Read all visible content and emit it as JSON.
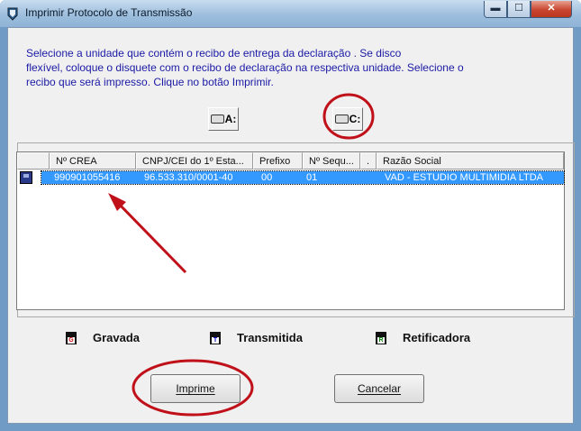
{
  "window": {
    "title": "Imprimir Protocolo de Transmissão",
    "minimize_glyph": "▬",
    "maximize_glyph": "☐",
    "close_glyph": "✕"
  },
  "instructions": [
    "Selecione a unidade que contém o recibo de entrega da declaração . Se disco",
    "flexível, coloque o disquete com o recibo de declaração na respectiva unidade. Selecione o",
    "recibo que será impresso. Clique no botão Imprimir."
  ],
  "drives": {
    "a_label": "A:",
    "c_label": "C:"
  },
  "table": {
    "columns": [
      "Nº CREA",
      "CNPJ/CEI do 1º Esta...",
      "Prefixo",
      "Nº Sequ...",
      ".",
      "Razão Social"
    ],
    "rows": [
      {
        "crea": "990901055416",
        "cnpj": "96.533.310/0001-40",
        "prefixo": "00",
        "sequencia": "01",
        "dot": "",
        "razao_social": "VAD - ESTUDIO MULTIMIDIA LTDA"
      }
    ]
  },
  "legend": [
    {
      "label": "Gravada",
      "letter": "G",
      "color": "#cc0000"
    },
    {
      "label": "Transmitida",
      "letter": "T",
      "color": "#0000cc"
    },
    {
      "label": "Retificadora",
      "letter": "R",
      "color": "#008000"
    }
  ],
  "buttons": {
    "print": "Imprime",
    "cancel": "Cancelar"
  },
  "colors": {
    "annotation": "#c0101a",
    "selection": "#3399ff",
    "instruction_text": "#1a1aa6"
  }
}
